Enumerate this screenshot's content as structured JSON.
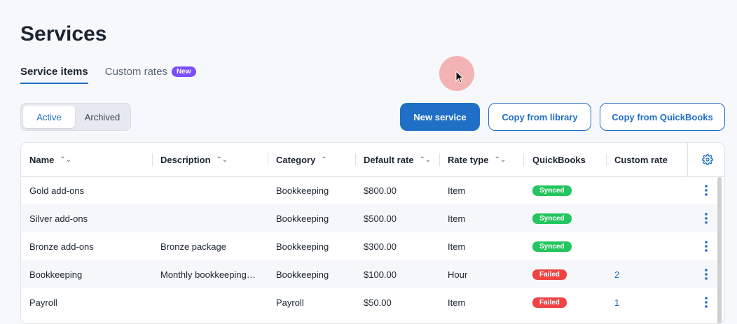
{
  "page": {
    "title": "Services"
  },
  "tabs": [
    {
      "label": "Service items"
    },
    {
      "label": "Custom rates",
      "badge": "New"
    }
  ],
  "toggle": {
    "active": "Active",
    "archived": "Archived"
  },
  "actions": {
    "new_service": "New service",
    "copy_library": "Copy from library",
    "copy_quickbooks": "Copy from QuickBooks"
  },
  "table": {
    "columns": {
      "name": "Name",
      "description": "Description",
      "category": "Category",
      "default_rate": "Default rate",
      "rate_type": "Rate type",
      "quickbooks": "QuickBooks",
      "custom_rate": "Custom rate"
    },
    "rows": [
      {
        "name": "Gold add-ons",
        "description": "",
        "category": "Bookkeeping",
        "rate": "$800.00",
        "rate_type": "Item",
        "qb": "Synced",
        "custom": ""
      },
      {
        "name": "Silver add-ons",
        "description": "",
        "category": "Bookkeeping",
        "rate": "$500.00",
        "rate_type": "Item",
        "qb": "Synced",
        "custom": ""
      },
      {
        "name": "Bronze add-ons",
        "description": "Bronze package",
        "category": "Bookkeeping",
        "rate": "$300.00",
        "rate_type": "Item",
        "qb": "Synced",
        "custom": ""
      },
      {
        "name": "Bookkeeping",
        "description": "Monthly bookkeeping…",
        "category": "Bookkeeping",
        "rate": "$100.00",
        "rate_type": "Hour",
        "qb": "Failed",
        "custom": "2"
      },
      {
        "name": "Payroll",
        "description": "",
        "category": "Payroll",
        "rate": "$50.00",
        "rate_type": "Item",
        "qb": "Failed",
        "custom": "1"
      }
    ]
  },
  "colors": {
    "accent": "#1f6fc6",
    "synced": "#22c55e",
    "failed": "#ef4444",
    "badge": "#7c4dff"
  },
  "icons": {
    "settings": "gear-icon",
    "row_menu": "kebab-menu-icon",
    "sort": "sort-icon"
  }
}
